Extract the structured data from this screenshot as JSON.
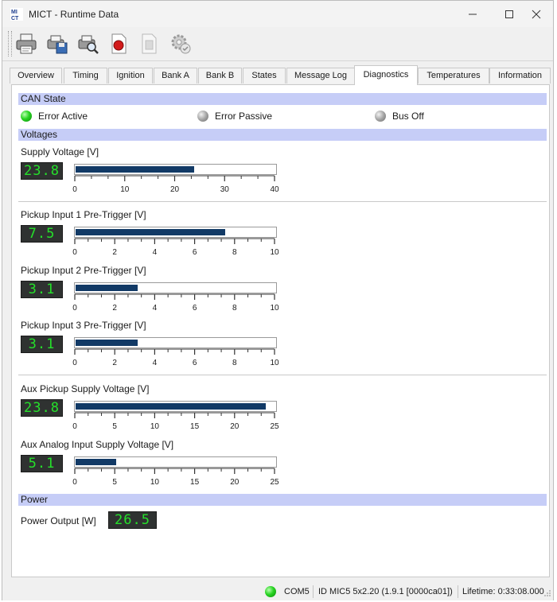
{
  "window": {
    "title": "MICT - Runtime Data",
    "logo_text": "MI CT"
  },
  "toolbar": {
    "icons": [
      "printer-icon",
      "save-disk-icon",
      "inspect-icon",
      "record-icon",
      "document-icon",
      "settings-gear-icon"
    ]
  },
  "tabs": [
    {
      "label": "Overview"
    },
    {
      "label": "Timing"
    },
    {
      "label": "Ignition"
    },
    {
      "label": "Bank A"
    },
    {
      "label": "Bank B"
    },
    {
      "label": "States"
    },
    {
      "label": "Message Log"
    },
    {
      "label": "Diagnostics",
      "active": true
    },
    {
      "label": "Temperatures"
    },
    {
      "label": "Information"
    }
  ],
  "can_state": {
    "heading": "CAN State",
    "indicators": [
      {
        "label": "Error Active",
        "state": "on",
        "color": "#29d423"
      },
      {
        "label": "Error Passive",
        "state": "off",
        "color": "#a5a5a5"
      },
      {
        "label": "Bus Off",
        "state": "off",
        "color": "#a5a5a5"
      }
    ]
  },
  "voltages": {
    "heading": "Voltages",
    "measurements": [
      {
        "label": "Supply Voltage [V]",
        "display": "23.8",
        "value": 23.8,
        "max": 40,
        "ticks": [
          "0",
          "10",
          "20",
          "30",
          "40"
        ]
      },
      {
        "label": "Pickup Input 1 Pre-Trigger [V]",
        "display": "7.5",
        "value": 7.5,
        "max": 10,
        "ticks": [
          "0",
          "2",
          "4",
          "6",
          "8",
          "10"
        ]
      },
      {
        "label": "Pickup Input 2 Pre-Trigger [V]",
        "display": "3.1",
        "value": 3.1,
        "max": 10,
        "ticks": [
          "0",
          "2",
          "4",
          "6",
          "8",
          "10"
        ]
      },
      {
        "label": "Pickup Input 3 Pre-Trigger [V]",
        "display": "3.1",
        "value": 3.1,
        "max": 10,
        "ticks": [
          "0",
          "2",
          "4",
          "6",
          "8",
          "10"
        ]
      },
      {
        "label": "Aux Pickup Supply Voltage [V]",
        "display": "23.8",
        "value": 23.8,
        "max": 25,
        "ticks": [
          "0",
          "5",
          "10",
          "15",
          "20",
          "25"
        ]
      },
      {
        "label": "Aux Analog Input Supply Voltage [V]",
        "display": "5.1",
        "value": 5.1,
        "max": 25,
        "ticks": [
          "0",
          "5",
          "10",
          "15",
          "20",
          "25"
        ]
      }
    ]
  },
  "power": {
    "heading": "Power",
    "label": "Power Output [W]",
    "display": "26.5"
  },
  "statusbar": {
    "connection_led": "#29d423",
    "port": "COM5",
    "device_id": "ID MIC5 5x2.20 (1.9.1 [0000ca01])",
    "lifetime": "Lifetime: 0:33:08.000"
  },
  "colors": {
    "accent_header": "#c6cdf7",
    "bar_fill": "#123a66",
    "lcd_text": "#25e02a",
    "lcd_bg": "#2f3231"
  }
}
